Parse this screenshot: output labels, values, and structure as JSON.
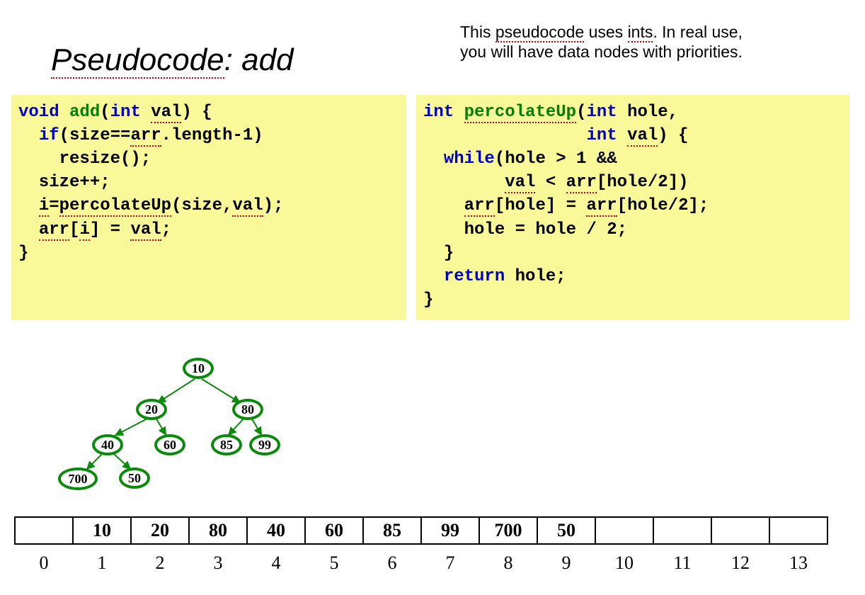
{
  "title_part1": "Pseudocode",
  "title_part2": ": add",
  "note_line1a": "This ",
  "note_line1b": "pseudocode",
  "note_line1c": " uses ",
  "note_line1d": "ints",
  "note_line1e": ".  In real use,",
  "note_line2": "you will have data nodes with priorities.",
  "code_left": {
    "l1a": "void",
    "l1b": " ",
    "l1c": "add",
    "l1d": "(",
    "l1e": "int",
    "l1f": " ",
    "l1g": "val",
    "l1h": ") {",
    "l2a": "  ",
    "l2b": "if",
    "l2c": "(size==",
    "l2d": "arr",
    "l2e": ".length-1)",
    "l3": "    resize();",
    "l4": "  size++;",
    "l5a": "  ",
    "l5b": "i",
    "l5c": "=",
    "l5d": "percolateUp",
    "l5e": "(size,",
    "l5f": "val",
    "l5g": ");",
    "l6a": "  ",
    "l6b": "arr",
    "l6c": "[",
    "l6d": "i",
    "l6e": "] = ",
    "l6f": "val",
    "l6g": ";",
    "l7": "}"
  },
  "code_right": {
    "l1a": "int",
    "l1b": " ",
    "l1c": "percolateUp",
    "l1d": "(",
    "l1e": "int",
    "l1f": " hole,",
    "l2a": "                ",
    "l2b": "int",
    "l2c": " ",
    "l2d": "val",
    "l2e": ") {",
    "l3a": "  ",
    "l3b": "while",
    "l3c": "(hole > 1 &&",
    "l4a": "        ",
    "l4b": "val",
    "l4c": " < ",
    "l4d": "arr",
    "l4e": "[hole/2])",
    "l5a": "    ",
    "l5b": "arr",
    "l5c": "[hole] = ",
    "l5d": "arr",
    "l5e": "[hole/2];",
    "l6": "    hole = hole / 2;",
    "l7": "  }",
    "l8a": "  ",
    "l8b": "return",
    "l8c": " hole;",
    "l9": "}"
  },
  "tree": {
    "n1": "10",
    "n2": "20",
    "n3": "80",
    "n4": "40",
    "n5": "60",
    "n6": "85",
    "n7": "99",
    "n8": "700",
    "n9": "50"
  },
  "array": [
    "",
    "10",
    "20",
    "80",
    "40",
    "60",
    "85",
    "99",
    "700",
    "50",
    "",
    "",
    "",
    ""
  ],
  "indices": [
    "0",
    "1",
    "2",
    "3",
    "4",
    "5",
    "6",
    "7",
    "8",
    "9",
    "10",
    "11",
    "12",
    "13"
  ]
}
